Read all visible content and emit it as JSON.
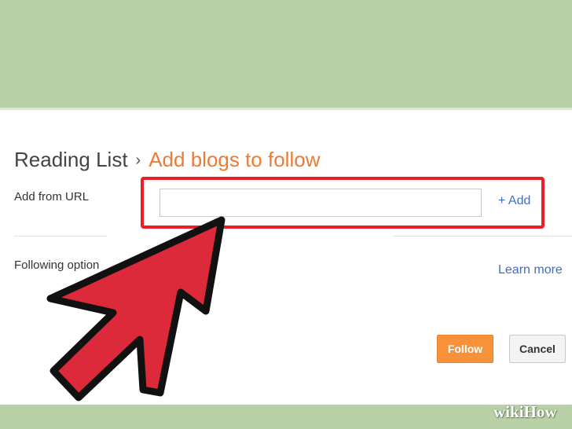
{
  "breadcrumb": {
    "root": "Reading List",
    "separator": "›",
    "current": "Add blogs to follow"
  },
  "form": {
    "url_label": "Add from URL",
    "url_value": "",
    "add_link": "+ Add",
    "following_label": "Following option",
    "learn_more": "Learn more"
  },
  "buttons": {
    "follow": "Follow",
    "cancel": "Cancel"
  },
  "watermark": "wikiHow",
  "colors": {
    "accent_orange": "#ee7a33",
    "highlight_red": "#ee1c25",
    "arrow_red": "#dc2a3a",
    "background_green": "#b8d1a6",
    "link_blue": "#3f6fc4"
  }
}
